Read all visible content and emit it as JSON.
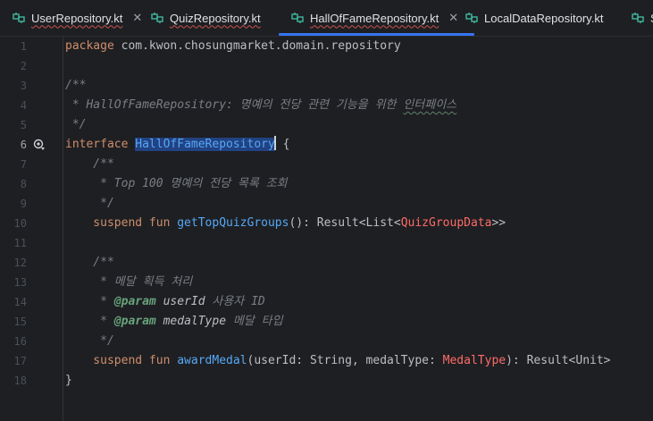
{
  "tabs": [
    {
      "label": "UserRepository.kt",
      "typo": true,
      "closable": true,
      "active": false
    },
    {
      "label": "QuizRepository.kt",
      "typo": true,
      "closable": false,
      "active": false
    },
    {
      "label": "HallOfFameRepository.kt",
      "typo": true,
      "closable": true,
      "active": true
    },
    {
      "label": "LocalDataRepository.kt",
      "typo": false,
      "closable": false,
      "active": false
    },
    {
      "label": "S",
      "typo": false,
      "closable": false,
      "active": false
    }
  ],
  "close_glyph": "✕",
  "line_numbers": [
    "1",
    "2",
    "3",
    "4",
    "5",
    "6",
    "7",
    "8",
    "9",
    "10",
    "11",
    "12",
    "13",
    "14",
    "15",
    "16",
    "17",
    "18"
  ],
  "current_line": "6",
  "code": {
    "l1_kw": "package",
    "l1_rest": " com.kwon.chosungmarket.domain.repository",
    "l3": "/**",
    "l4_star": " * ",
    "l4_text": "HallOfFameRepository: 명예의 전당 관련 기능을 위한 ",
    "l4_typo": "인터페이스",
    "l5": " */",
    "l6_kw": "interface",
    "l6_name": "HallOfFameRepository",
    "l6_rest": " {",
    "l7": "    /**",
    "l8": "     * Top 100 명예의 전당 목록 조회",
    "l9": "     */",
    "l10_kw1": "    suspend",
    "l10_kw2": " fun",
    "l10_fn": " getTopQuizGroups",
    "l10_a": "(): Result<List<",
    "l10_t": "QuizGroupData",
    "l10_b": ">>",
    "l12": "    /**",
    "l13": "     * 메달 획득 처리",
    "l14_star": "     * ",
    "l14_tag": "@param",
    "l14_p": " userId",
    "l14_d": " 사용자 ID",
    "l15_star": "     * ",
    "l15_tag": "@param",
    "l15_p": " medalType",
    "l15_d": " 메달 타입",
    "l16": "     */",
    "l17_kw1": "    suspend",
    "l17_kw2": " fun",
    "l17_fn": " awardMedal",
    "l17_a": "(userId: String, medalType: ",
    "l17_t": "MedalType",
    "l17_b": "): Result<Unit>",
    "l18": "}"
  },
  "colors": {
    "background": "#1e1f22",
    "keyword": "#cf8e6d",
    "function": "#56a8f5",
    "comment": "#7a7e85",
    "kdoc_tag": "#67a37c",
    "red_type": "#ff6b68",
    "selection": "#214283",
    "active_tab_underline": "#3574f0",
    "file_icon": "#3fb8a0"
  },
  "icons": {
    "file_icon": "kotlin-interface-file-icon",
    "gutter_icon": "implementations-gutter-icon"
  }
}
